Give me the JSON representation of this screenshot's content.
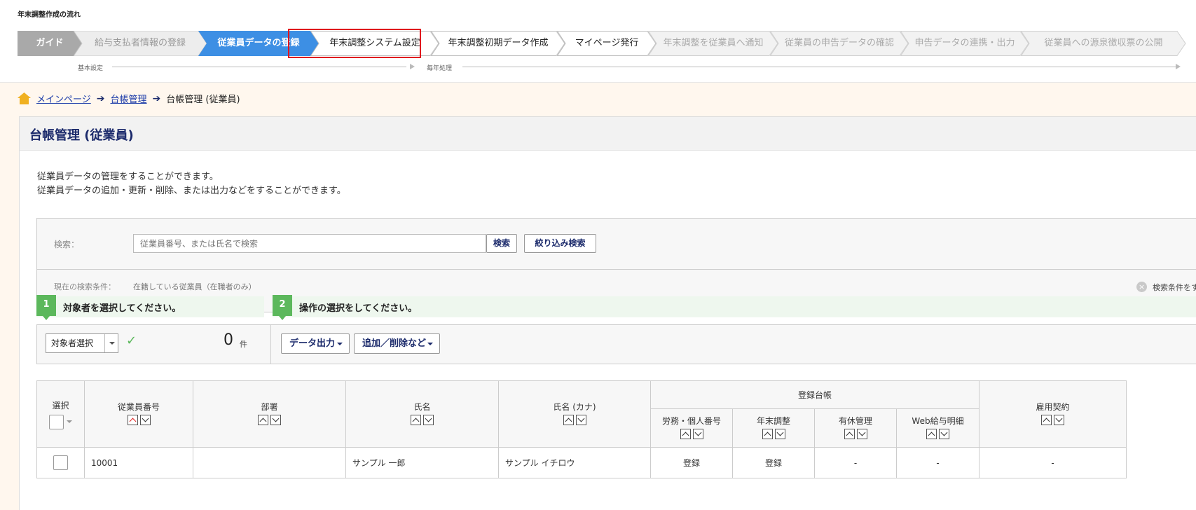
{
  "flow": {
    "title": "年末調整作成の流れ",
    "steps": [
      {
        "label": "ガイド",
        "state": "guide"
      },
      {
        "label": "給与支払者情報の登録",
        "state": "done"
      },
      {
        "label": "従業員データの登録",
        "state": "active"
      },
      {
        "label": "年末調整システム設定",
        "state": "todo"
      },
      {
        "label": "年末調整初期データ作成",
        "state": "todo"
      },
      {
        "label": "マイページ発行",
        "state": "todo"
      },
      {
        "label": "年末調整を従業員へ通知",
        "state": "future"
      },
      {
        "label": "従業員の申告データの確認",
        "state": "future"
      },
      {
        "label": "申告データの連携・出力",
        "state": "future"
      },
      {
        "label": "従業員への源泉徴収票の公開",
        "state": "future"
      }
    ],
    "phase_basic": "基本設定",
    "phase_yearly": "毎年処理"
  },
  "colors": {
    "guide": "#a9a9a9",
    "active": "#3d8fe4",
    "done": "#ededed",
    "todo": "#ffffff",
    "future": "#f2f2f2",
    "highlight": "#e0141e",
    "accent_green": "#5cb85c",
    "navy": "#1b2a6b"
  },
  "breadcrumb": {
    "home": "メインページ",
    "ledger": "台帳管理",
    "current": "台帳管理 (従業員)"
  },
  "page": {
    "title": "台帳管理 (従業員)",
    "desc1": "従業員データの管理をすることができます。",
    "desc2": "従業員データの追加・更新・削除、または出力などをすることができます。"
  },
  "search": {
    "label": "検索：",
    "placeholder": "従業員番号、または氏名で検索",
    "search_button": "検索",
    "filter_button": "絞り込み検索",
    "condition_label": "現在の検索条件：",
    "condition_value": "在籍している従業員（在職者のみ）",
    "clear_all": "検索条件をすべて解"
  },
  "guide_steps": {
    "step1_num": "1",
    "step1_text": "対象者を選択してください。",
    "step2_num": "2",
    "step2_text": "操作の選択をしてください。"
  },
  "ops": {
    "target_select": "対象者選択",
    "count": "0",
    "count_unit": "件",
    "data_output": "データ出力",
    "add_delete": "追加／削除など"
  },
  "table": {
    "headers": {
      "select": "選択",
      "emp_no": "従業員番号",
      "dept": "部署",
      "name": "氏名",
      "kana": "氏名 (カナ)",
      "ledger_group": "登録台帳",
      "labor": "労務・個人番号",
      "nenmatsu": "年末調整",
      "paid_leave": "有休管理",
      "web_payslip": "Web給与明細",
      "contract": "雇用契約"
    },
    "rows": [
      {
        "emp_no": "10001",
        "dept": "",
        "name": "サンプル 一郎",
        "kana": "サンプル イチロウ",
        "labor": "登録",
        "nenmatsu": "登録",
        "paid_leave": "-",
        "web_payslip": "-",
        "contract": "-"
      }
    ]
  }
}
